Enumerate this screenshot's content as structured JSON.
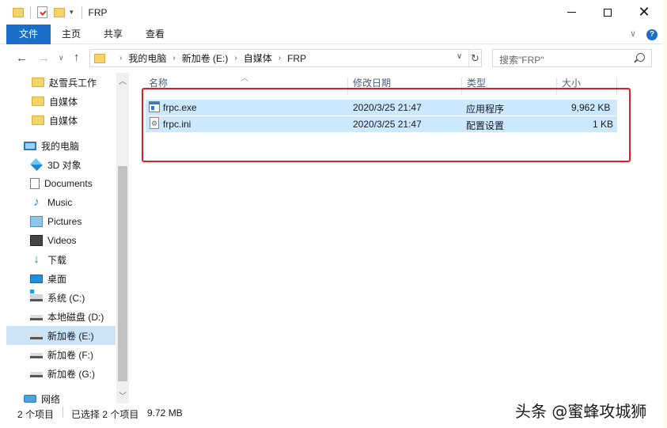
{
  "window": {
    "title": "FRP",
    "controls": {
      "minimize": "—",
      "maximize": "□",
      "close": "✕"
    }
  },
  "ribbon": {
    "tabs": [
      "文件",
      "主页",
      "共享",
      "查看"
    ],
    "help": "?"
  },
  "address": {
    "breadcrumbs": [
      "我的电脑",
      "新加卷 (E:)",
      "自媒体",
      "FRP"
    ],
    "search_placeholder": "搜索\"FRP\""
  },
  "navpane": {
    "quick_access": [
      {
        "label": "赵雪兵工作",
        "icon": "folder-icon"
      },
      {
        "label": "自媒体",
        "icon": "folder-icon"
      },
      {
        "label": "自媒体",
        "icon": "folder-icon"
      }
    ],
    "this_pc": {
      "label": "我的电脑",
      "icon": "computer-icon"
    },
    "pc_items": [
      {
        "label": "3D 对象",
        "icon": "3d-objects-icon"
      },
      {
        "label": "Documents",
        "icon": "documents-icon"
      },
      {
        "label": "Music",
        "icon": "music-icon"
      },
      {
        "label": "Pictures",
        "icon": "pictures-icon"
      },
      {
        "label": "Videos",
        "icon": "videos-icon"
      },
      {
        "label": "下载",
        "icon": "download-icon"
      },
      {
        "label": "桌面",
        "icon": "desktop-icon"
      },
      {
        "label": "系统 (C:)",
        "icon": "system-drive-icon"
      },
      {
        "label": "本地磁盘 (D:)",
        "icon": "drive-icon"
      },
      {
        "label": "新加卷 (E:)",
        "icon": "drive-icon",
        "selected": true
      },
      {
        "label": "新加卷 (F:)",
        "icon": "drive-icon"
      },
      {
        "label": "新加卷 (G:)",
        "icon": "drive-icon"
      }
    ],
    "network": {
      "label": "网络",
      "icon": "network-icon"
    }
  },
  "files": {
    "columns": [
      "名称",
      "修改日期",
      "类型",
      "大小"
    ],
    "rows": [
      {
        "name": "frpc.exe",
        "modified": "2020/3/25 21:47",
        "type": "应用程序",
        "size": "9,962 KB",
        "icon": "exe-icon"
      },
      {
        "name": "frpc.ini",
        "modified": "2020/3/25 21:47",
        "type": "配置设置",
        "size": "1 KB",
        "icon": "ini-icon"
      }
    ]
  },
  "status": {
    "count": "2 个项目",
    "selected": "已选择 2 个项目",
    "size": "9.72 MB"
  },
  "watermark": "头条 @蜜蜂攻城狮",
  "colors": {
    "accent": "#1a6ec7",
    "selection": "#cce8ff",
    "highlight_box": "#e21d25"
  }
}
